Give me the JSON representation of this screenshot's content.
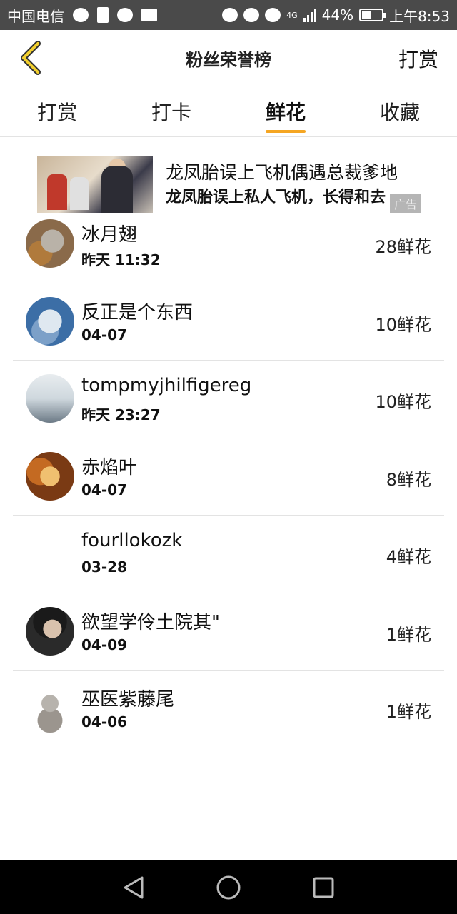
{
  "status_bar": {
    "carrier": "中国电信",
    "network": "4G",
    "battery": "44%",
    "time": "上午8:53"
  },
  "header": {
    "title": "粉丝荣誉榜",
    "action_label": "打赏"
  },
  "tabs": [
    {
      "label": "打赏"
    },
    {
      "label": "打卡"
    },
    {
      "label": "鲜花",
      "active": true
    },
    {
      "label": "收藏"
    }
  ],
  "ad": {
    "title": "龙凤胎误上飞机偶遇总裁爹地",
    "description": "龙凤胎误上私人飞机，长得和去",
    "tag": "广告"
  },
  "fans": [
    {
      "name": "冰月翅",
      "time": "昨天 11:32",
      "count": "28鲜花"
    },
    {
      "name": "反正是个东西",
      "time": "04-07",
      "count": "10鲜花"
    },
    {
      "name": "tompmyjhilfigereg",
      "time": "昨天 23:27",
      "count": "10鲜花"
    },
    {
      "name": "赤焰叶",
      "time": "04-07",
      "count": "8鲜花"
    },
    {
      "name": "fourllokozk",
      "time": "03-28",
      "count": "4鲜花"
    },
    {
      "name": "欲望学伶土院其\"",
      "time": "04-09",
      "count": "1鲜花"
    },
    {
      "name": "巫医紫藤尾",
      "time": "04-06",
      "count": "1鲜花"
    }
  ]
}
